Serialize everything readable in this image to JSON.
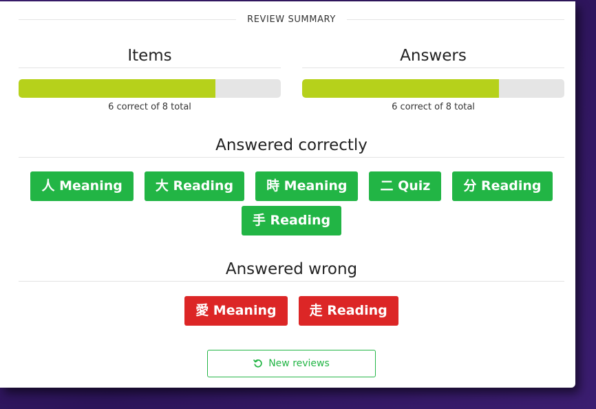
{
  "summary": {
    "header": "REVIEW SUMMARY"
  },
  "items": {
    "title": "Items",
    "correct": 6,
    "total": 8,
    "progress_fraction": 0.75,
    "caption": "6 correct of 8 total"
  },
  "answers": {
    "title": "Answers",
    "correct": 6,
    "total": 8,
    "progress_fraction": 0.75,
    "caption": "6 correct of 8 total"
  },
  "correct_section": {
    "title": "Answered correctly",
    "items": [
      {
        "label": "人 Meaning"
      },
      {
        "label": "大 Reading"
      },
      {
        "label": "時 Meaning"
      },
      {
        "label": "二 Quiz"
      },
      {
        "label": "分 Reading"
      },
      {
        "label": "手 Reading"
      }
    ]
  },
  "wrong_section": {
    "title": "Answered wrong",
    "items": [
      {
        "label": "愛 Meaning"
      },
      {
        "label": "走 Reading"
      }
    ]
  },
  "new_reviews_button": {
    "label": "New reviews",
    "icon": "undo-icon"
  },
  "colors": {
    "correct": "#22b545",
    "wrong": "#dc2626",
    "progress": "#b6d11b",
    "background": "#2c1459"
  }
}
